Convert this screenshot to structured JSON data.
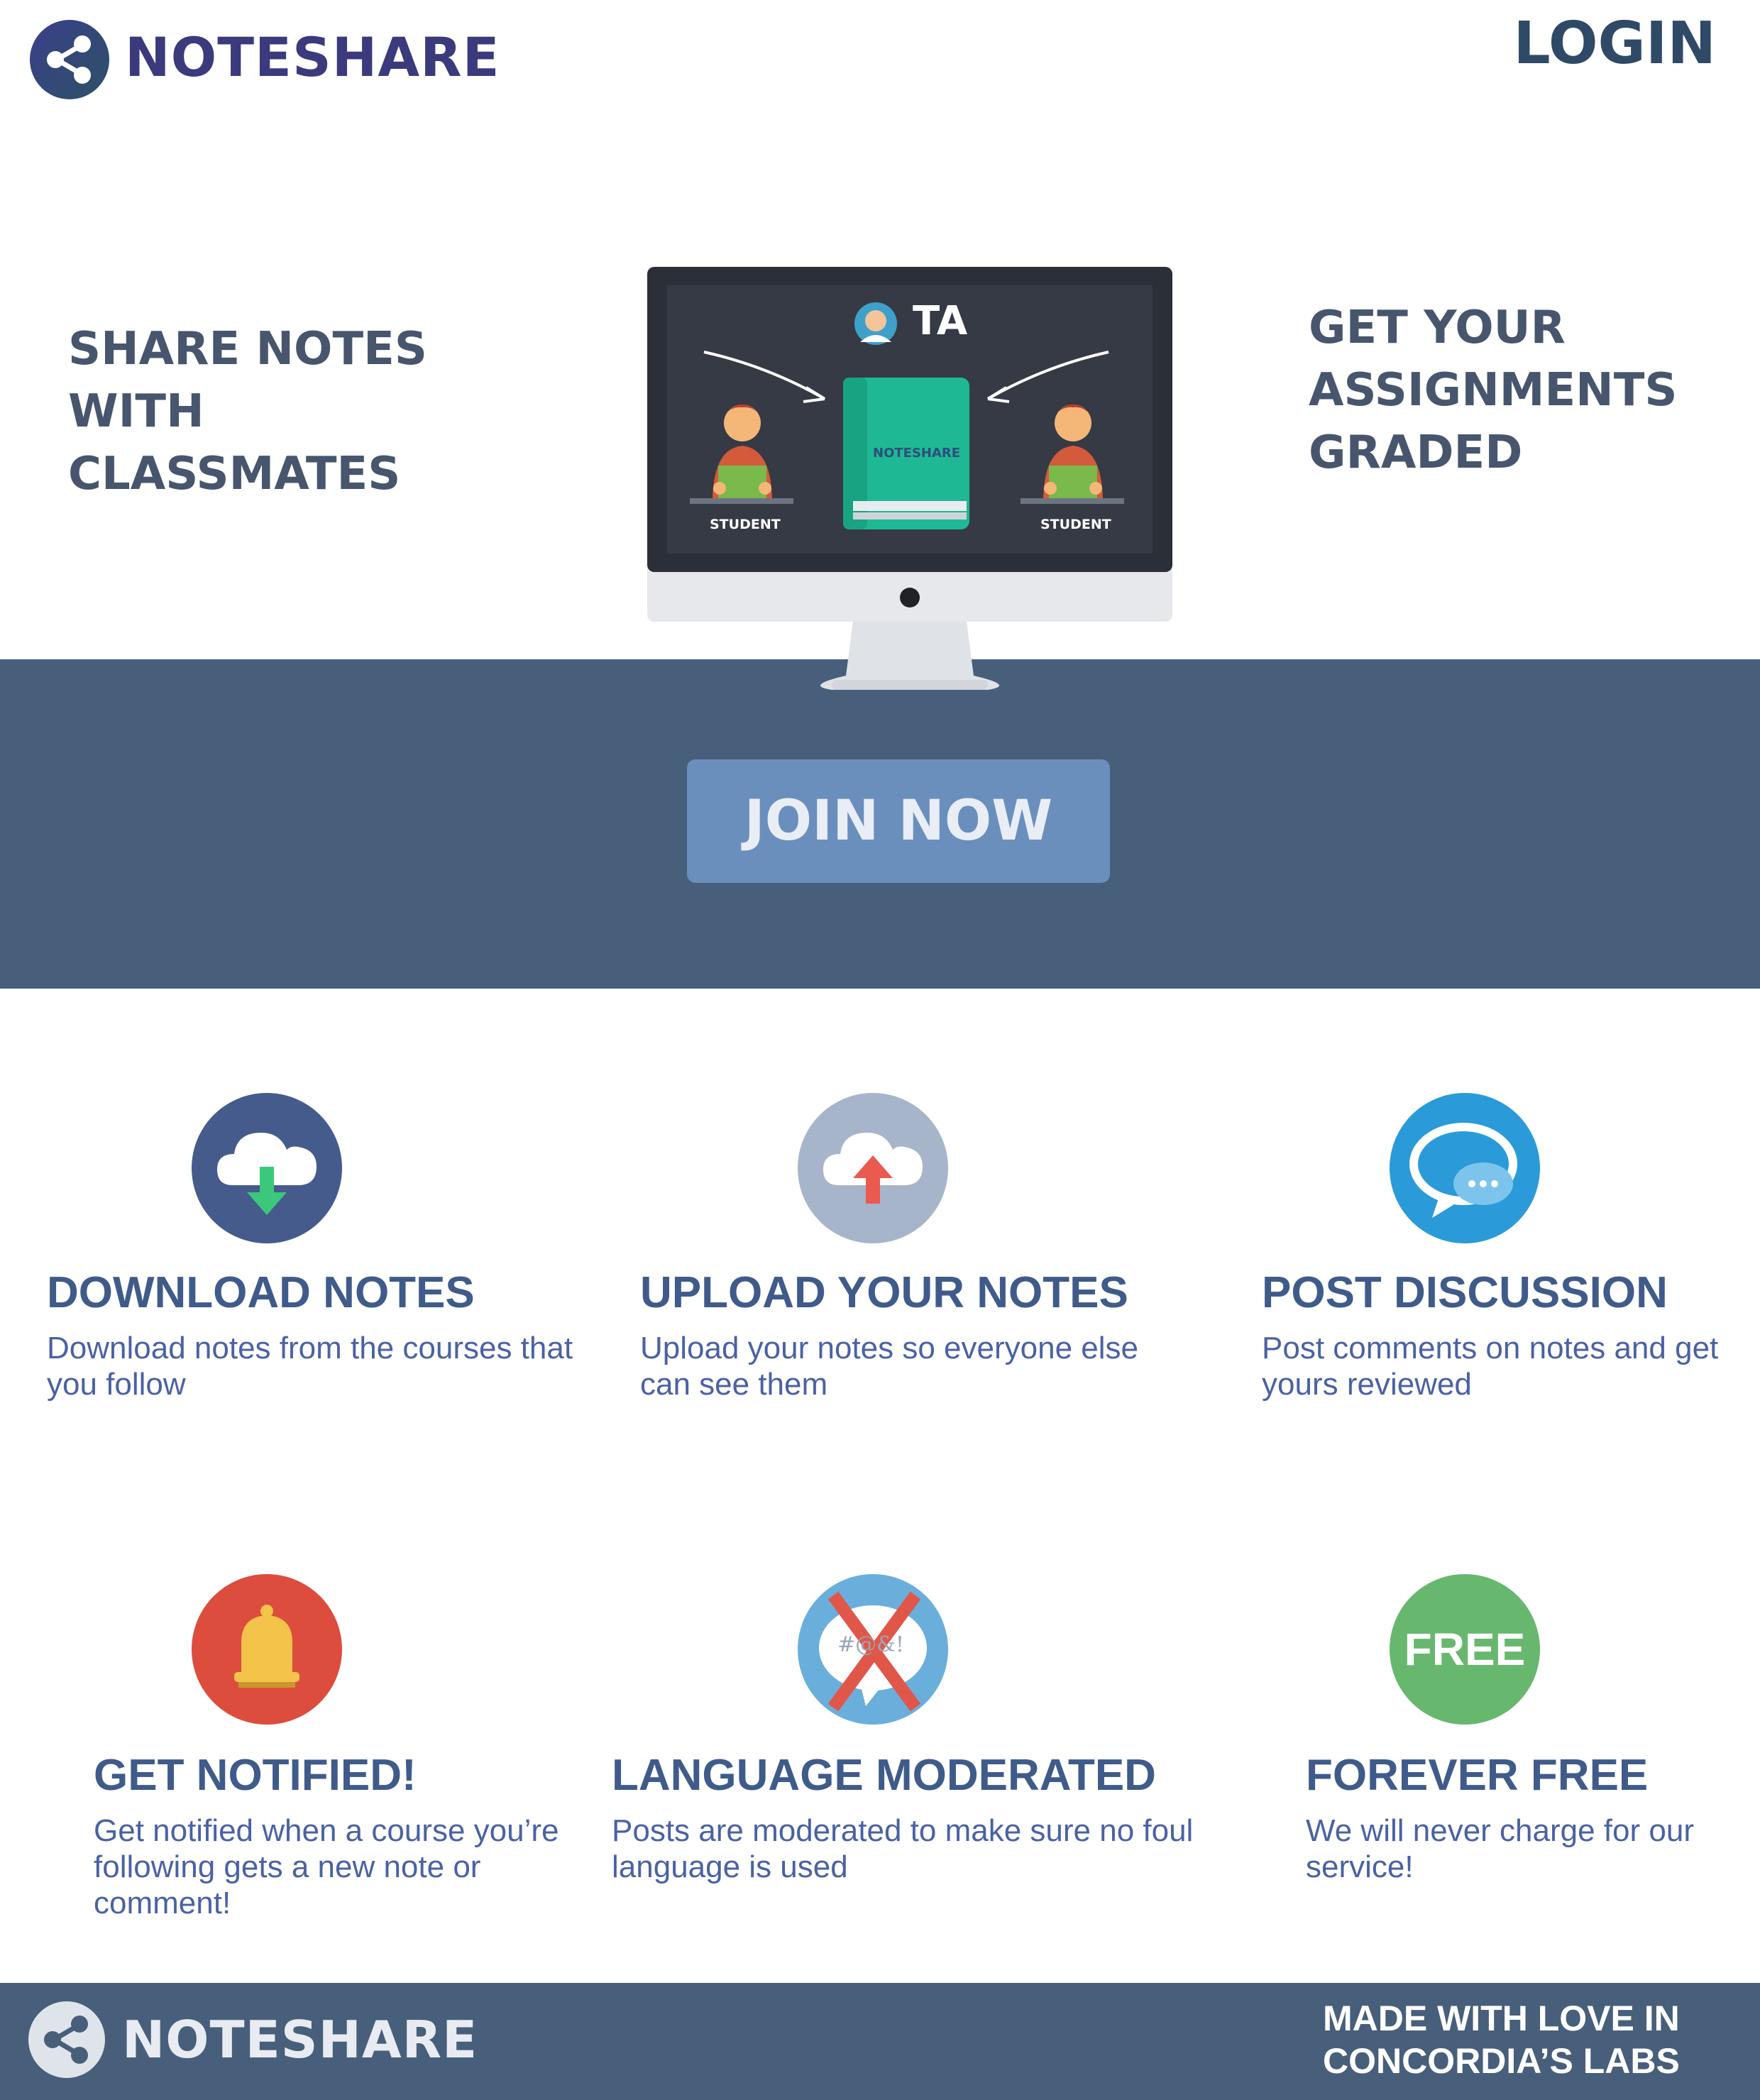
{
  "header": {
    "logo_text": "NOTESHARE",
    "login_label": "LOGIN"
  },
  "hero": {
    "left_text": "SHARE NOTES WITH CLASSMATES",
    "right_text": "GET YOUR ASSIGNMENTS GRADED",
    "illustration": {
      "ta_label": "TA",
      "book_label": "NOTESHARE",
      "student_left_label": "STUDENT",
      "student_right_label": "STUDENT"
    },
    "join_label": "JOIN NOW"
  },
  "features": [
    {
      "icon": "cloud-download-icon",
      "title": "DOWNLOAD NOTES",
      "desc": "Download notes from the courses that you follow"
    },
    {
      "icon": "cloud-upload-icon",
      "title": "UPLOAD YOUR NOTES",
      "desc": "Upload your notes so everyone else can see them"
    },
    {
      "icon": "chat-bubble-icon",
      "title": "POST DISCUSSION",
      "desc": "Post comments on notes and get yours reviewed"
    },
    {
      "icon": "bell-icon",
      "title": "GET NOTIFIED!",
      "desc": "Get notified when a course you’re following gets a new note or comment!"
    },
    {
      "icon": "moderation-icon",
      "title": "LANGUAGE MODERATED",
      "desc": "Posts are moderated to make sure no foul language is used",
      "icon_text": "#@&!"
    },
    {
      "icon": "free-badge-icon",
      "title": "FOREVER FREE",
      "desc": "We will never charge for our service!",
      "icon_text": "FREE"
    }
  ],
  "footer": {
    "logo_text": "NOTESHARE",
    "tagline": "MADE WITH LOVE IN CONCORDIA’S LABS"
  },
  "colors": {
    "brand_dark": "#3b3a7c",
    "band": "#475f7a",
    "join_button": "#6b8fbd",
    "feature_title": "#3f5b8a",
    "feature_text": "#4a62a3"
  }
}
